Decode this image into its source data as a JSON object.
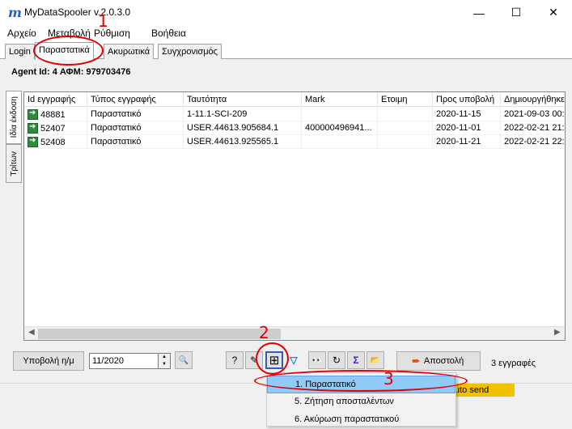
{
  "window": {
    "logo_glyph": "m",
    "title": "MyDataSpooler v.2.0.3.0",
    "minimize_glyph": "—",
    "maximize_glyph": "☐",
    "close_glyph": "✕"
  },
  "menu": [
    "Αρχείο",
    "Μεταβολή",
    "Ρύθμιση",
    "Βοήθεια"
  ],
  "tabs": [
    {
      "label": "Login",
      "active": false
    },
    {
      "label": "Παραστατικά",
      "active": true
    },
    {
      "label": "Ακυρωτικά",
      "active": false
    },
    {
      "label": "Συγχρονισμός",
      "active": false
    }
  ],
  "agent": {
    "label": "Agent Id: 4 ΑΦΜ: 979703476"
  },
  "side_tabs": [
    "Ιδία έκδοση",
    "Τρίτων"
  ],
  "grid": {
    "columns": [
      "Id εγγραφής",
      "Τύπος εγγραφής",
      "Ταυτότητα",
      "Mark",
      "Ετοιμη",
      "Προς υποβολή",
      "Δημιουργήθηκε"
    ],
    "rows": [
      [
        "48881",
        "Παραστατικό",
        "1-11.1-SCI-209",
        "",
        "",
        "2020-11-15",
        "2021-09-03 00:3"
      ],
      [
        "52407",
        "Παραστατικό",
        "USER.44613.905684.1",
        "400000496941...",
        "",
        "2020-11-01",
        "2022-02-21 21:4"
      ],
      [
        "52408",
        "Παραστατικό",
        "USER.44613.925565.1",
        "",
        "",
        "2020-11-21",
        "2022-02-21 22:1"
      ]
    ]
  },
  "toolbar": {
    "submit_label": "Υποβολή η/μ",
    "period_value": "11/2020",
    "search_glyph": "🔍",
    "help_glyph": "?",
    "edit_glyph": "✎",
    "add_glyph": "⊞",
    "filter_glyph": "▽",
    "find_glyph": "👀",
    "refresh_glyph": "↻",
    "sum_glyph": "Σ",
    "export_glyph": "📂",
    "send_label": "Αποστολή",
    "record_count": "3 εγγραφές"
  },
  "status": {
    "auto_send_label": "uto send"
  },
  "popup_menu": [
    {
      "label": "1. Παραστατικό",
      "highlighted": true
    },
    {
      "label": "5. Ζήτηση αποσταλέντων",
      "highlighted": false
    },
    {
      "label": "6. Ακύρωση παραστατικού",
      "highlighted": false
    }
  ],
  "annotations": [
    "1",
    "2",
    "3"
  ],
  "colors": {
    "annotation": "#e00000",
    "highlight": "#91c9f7",
    "auto_send": "#f2c100",
    "row_icon": "#2e8b3e"
  }
}
